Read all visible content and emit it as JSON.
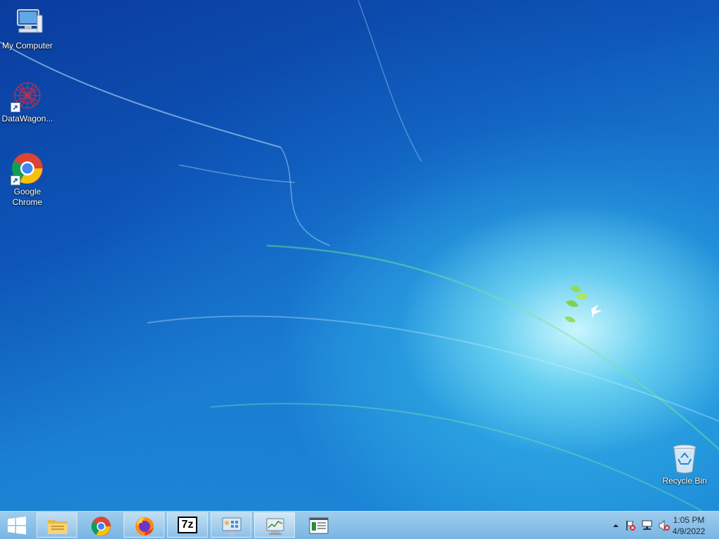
{
  "desktop": {
    "icons": [
      {
        "label": "My Computer",
        "icon": "computer-icon"
      },
      {
        "label": "DataWagon...",
        "icon": "datawagon-icon"
      },
      {
        "label": "Google Chrome",
        "icon": "chrome-icon"
      },
      {
        "label": "Recycle Bin",
        "icon": "recycle-bin-icon"
      }
    ]
  },
  "taskbar": {
    "start": {
      "icon": "windows-logo-icon"
    },
    "pinned": [
      {
        "name": "file-explorer",
        "icon": "folder-icon"
      },
      {
        "name": "google-chrome",
        "icon": "chrome-icon"
      },
      {
        "name": "firefox",
        "icon": "firefox-icon"
      },
      {
        "name": "7-zip",
        "icon": "7zip-icon",
        "text": "7z"
      },
      {
        "name": "control-panel",
        "icon": "control-panel-icon"
      },
      {
        "name": "task-manager",
        "icon": "task-manager-icon"
      },
      {
        "name": "notepad",
        "icon": "window-app-icon"
      }
    ],
    "tray": {
      "icons": [
        "show-hidden-icons-arrow",
        "action-center-flag-icon",
        "network-icon",
        "volume-muted-icon"
      ],
      "time": "1:05 PM",
      "date": "4/9/2022"
    }
  },
  "colors": {
    "taskbar": "#8cc4ea",
    "desktop_dark": "#0a3c9e",
    "desktop_light": "#9fe6f7"
  }
}
